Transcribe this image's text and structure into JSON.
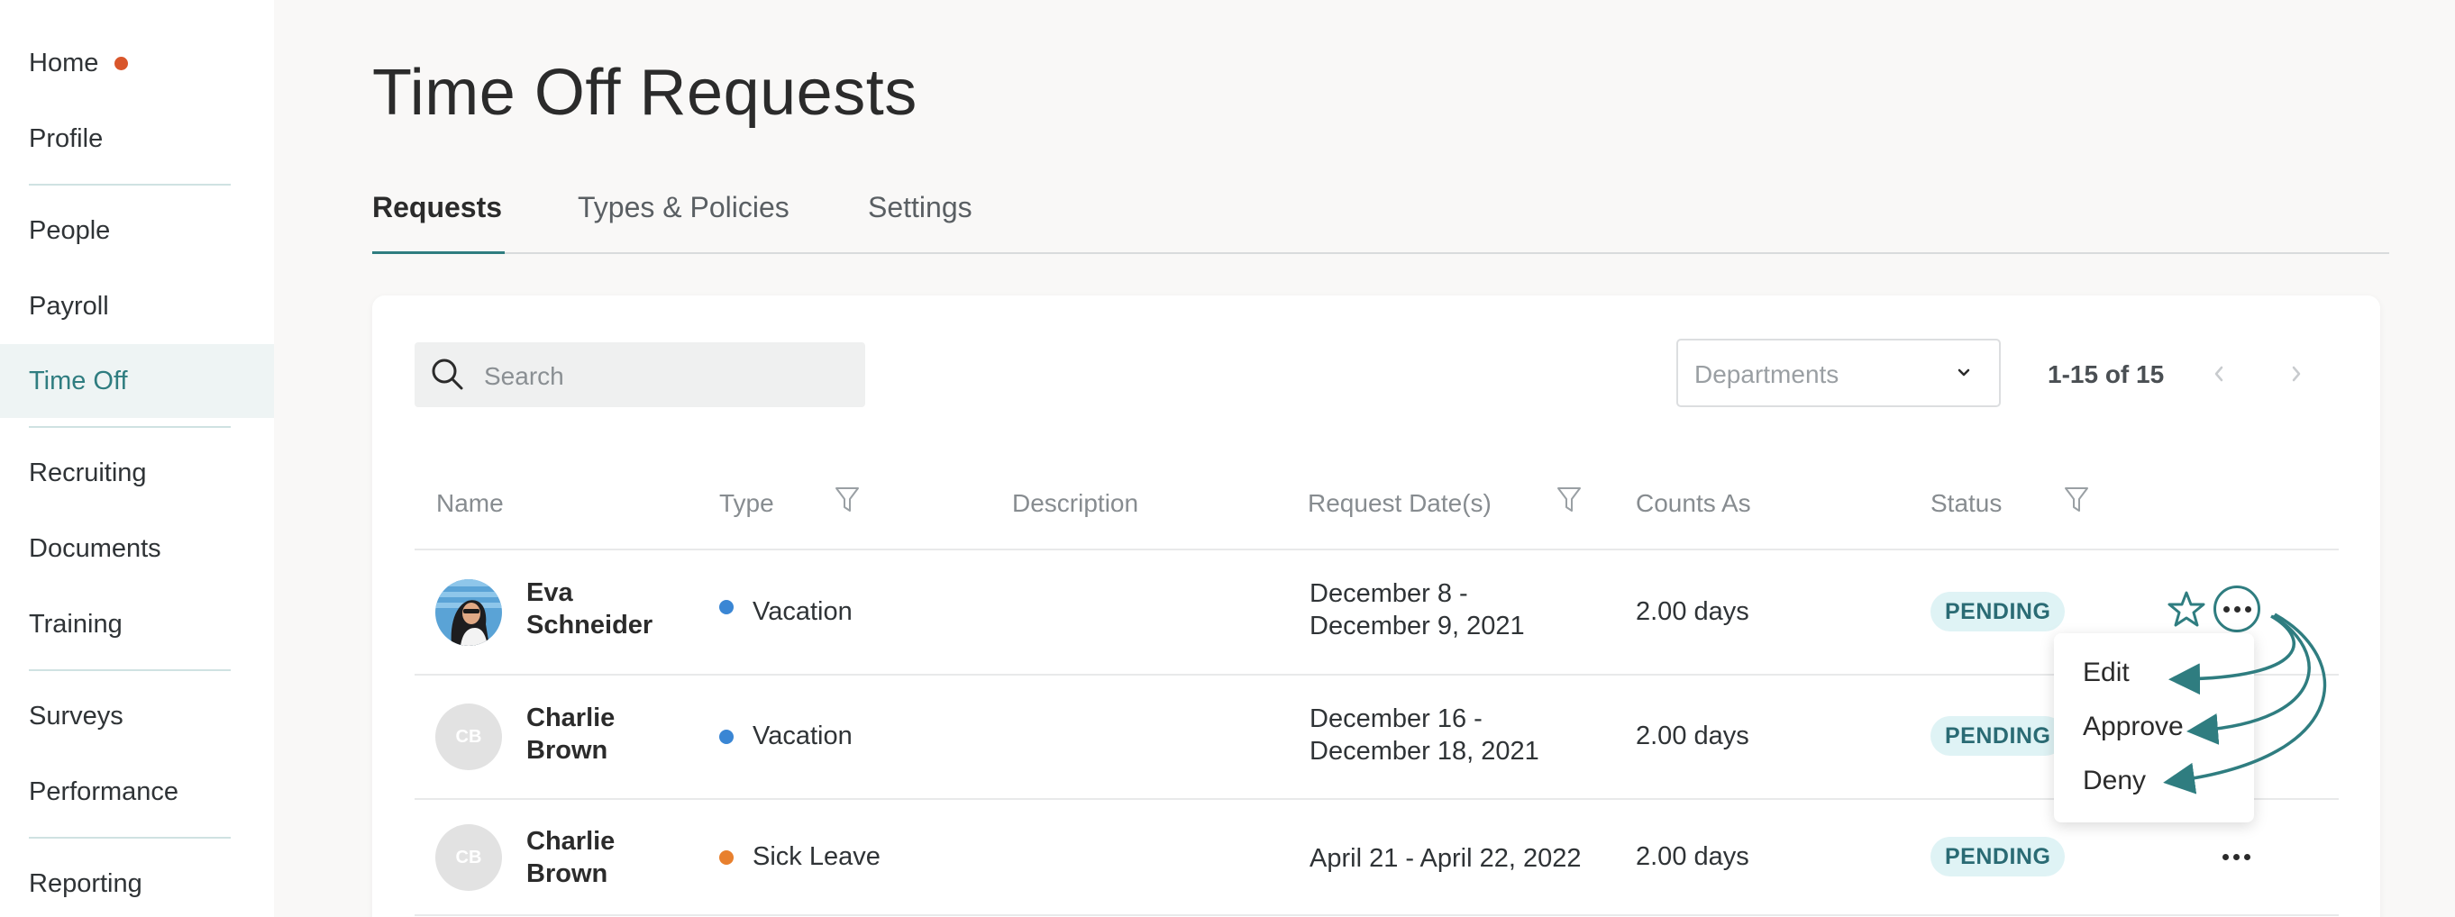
{
  "sidebar": {
    "items": [
      {
        "label": "Home",
        "dot": true
      },
      {
        "label": "Profile"
      },
      {
        "label": "People"
      },
      {
        "label": "Payroll"
      },
      {
        "label": "Time Off",
        "active": true
      },
      {
        "label": "Recruiting"
      },
      {
        "label": "Documents"
      },
      {
        "label": "Training"
      },
      {
        "label": "Surveys"
      },
      {
        "label": "Performance"
      },
      {
        "label": "Reporting"
      }
    ]
  },
  "page": {
    "title": "Time Off Requests"
  },
  "tabs": [
    {
      "label": "Requests",
      "active": true
    },
    {
      "label": "Types & Policies"
    },
    {
      "label": "Settings"
    }
  ],
  "toolbar": {
    "search_placeholder": "Search",
    "departments_placeholder": "Departments",
    "pagination": "1-15 of 15"
  },
  "table": {
    "columns": [
      "Name",
      "Type",
      "Description",
      "Request Date(s)",
      "Counts As",
      "Status"
    ],
    "rows": [
      {
        "name": "Eva Schneider",
        "name_line1": "Eva",
        "name_line2": "Schneider",
        "initials": "",
        "type": "Vacation",
        "type_color": "#3a86d4",
        "description": "",
        "date_line1": "December 8 -",
        "date_line2": "December 9, 2021",
        "counts_as": "2.00 days",
        "status": "PENDING"
      },
      {
        "name": "Charlie Brown",
        "name_line1": "Charlie",
        "name_line2": "Brown",
        "initials": "CB",
        "type": "Vacation",
        "type_color": "#3a86d4",
        "description": "",
        "date_line1": "December 16 -",
        "date_line2": "December 18, 2021",
        "counts_as": "2.00 days",
        "status": "PENDING"
      },
      {
        "name": "Charlie Brown",
        "name_line1": "Charlie",
        "name_line2": "Brown",
        "initials": "CB",
        "type": "Sick Leave",
        "type_color": "#e8802e",
        "description": "",
        "date_line1": "April 21 - April 22, 2022",
        "date_line2": "",
        "counts_as": "2.00 days",
        "status": "PENDING"
      }
    ]
  },
  "action_menu": {
    "items": [
      "Edit",
      "Approve",
      "Deny"
    ]
  },
  "colors": {
    "accent": "#2f7d80",
    "home_dot": "#d9562b",
    "badge_bg": "#dff3f5",
    "badge_text": "#2a6b74"
  }
}
